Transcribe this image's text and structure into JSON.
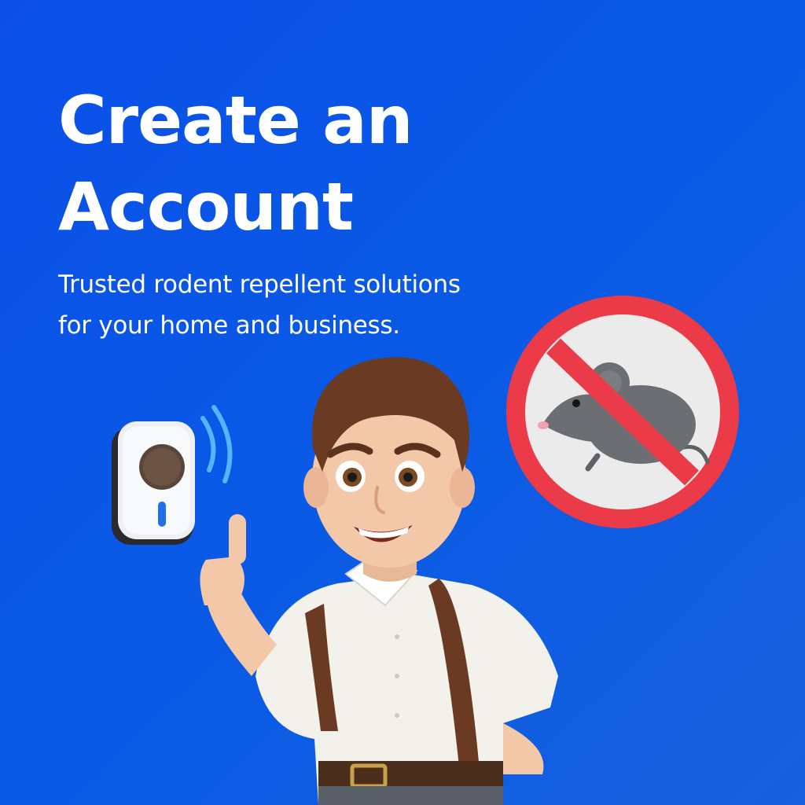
{
  "headline": {
    "line1": "Create an",
    "line2": "Account"
  },
  "subtitle": {
    "line1": "Trusted rodent repellent solutions",
    "line2": "for your home and business."
  },
  "icons": [
    "repeller-device-icon",
    "sound-waves-icon",
    "no-rodent-sign-icon",
    "mouse-icon"
  ],
  "colors": {
    "background": "#0b4fe8",
    "text": "#ffffff",
    "prohibition_red": "#ec3b48",
    "mouse_gray": "#6b6e72"
  }
}
